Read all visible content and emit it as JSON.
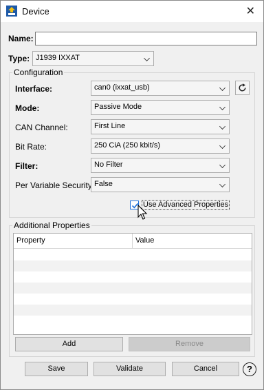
{
  "window": {
    "title": "Device",
    "close_glyph": "✕",
    "icon": "app-arrow-icon"
  },
  "form": {
    "name": {
      "label": "Name:",
      "value": ""
    },
    "type": {
      "label": "Type:",
      "value": "J1939 IXXAT"
    }
  },
  "configuration": {
    "group_title": "Configuration",
    "interface": {
      "label": "Interface:",
      "value": "can0 (ixxat_usb)"
    },
    "mode": {
      "label": "Mode:",
      "value": "Passive Mode"
    },
    "can_channel": {
      "label": "CAN Channel:",
      "value": "First Line"
    },
    "bit_rate": {
      "label": "Bit Rate:",
      "value": "250 CiA (250 kbit/s)"
    },
    "filter": {
      "label": "Filter:",
      "value": "No Filter"
    },
    "per_variable_security": {
      "label": "Per Variable Security:",
      "value": "False"
    },
    "use_advanced": {
      "label": "Use Advanced Properties",
      "checked": true
    },
    "refresh_icon": "refresh-icon"
  },
  "additional": {
    "group_title": "Additional Properties",
    "columns": [
      "Property",
      "Value"
    ],
    "rows": [],
    "add_label": "Add",
    "remove_label": "Remove"
  },
  "footer": {
    "save_label": "Save",
    "validate_label": "Validate",
    "cancel_label": "Cancel",
    "help_glyph": "?"
  },
  "colors": {
    "accent": "#1e6fd9",
    "brand": "#1e5aa8",
    "logo_yellow": "#f3c012"
  }
}
